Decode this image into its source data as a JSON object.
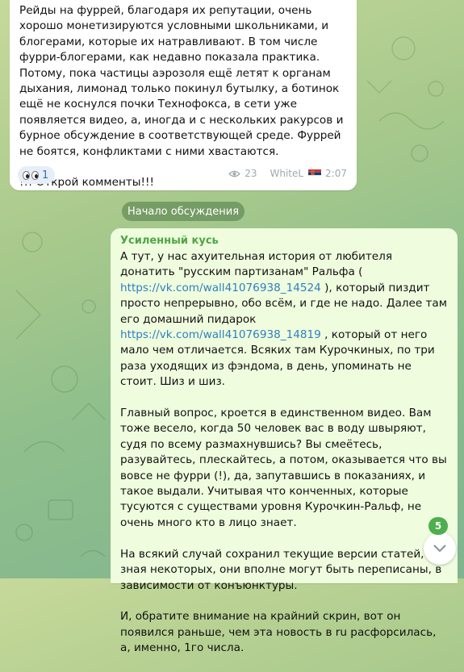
{
  "channel_post": {
    "text": "Рейды на фуррей, благодаря их репутации, очень хорошо монетизируются условными школьниками, и блогерами, которые их натравливают. В том числе фурри-блогерами, как недавно показала практика. Потому, пока частицы аэрозоля ещё летят к органам дыхания, лимонад только покинул бутылку, а ботинок ещё не коснулся почки Технофокса, в сети уже появляется видео, а, иногда и с нескольких ракурсов и бурное обсуждение в соответствующей среде. Фуррей не боятся, конфликтами с ними хвастаются.\n\n!!! Открой комменты!!!",
    "reaction": {
      "emoji": "eyes-icon",
      "count": "1"
    },
    "views": "23",
    "author_signature": "WhiteL",
    "flag": "serbia-flag-icon",
    "time": "2:07"
  },
  "divider": {
    "label": "Начало обсуждения"
  },
  "comment": {
    "author": "Усиленный кусь",
    "paragraphs": [
      [
        {
          "t": "А тут, у нас ахуительная история от любителя донатить \"русским партизанам\" Ральфа ( "
        },
        {
          "t": "https://vk.com/wall41076938_14524",
          "link": true
        },
        {
          "t": " ), который пиздит просто непрерывно, обо всём, и где не надо. Далее там его домашний пидарок "
        },
        {
          "t": "https://vk.com/wall41076938_14819",
          "link": true
        },
        {
          "t": " , который от него мало чем отличается. Всяких там Курочкиных, по три раза уходящих из фэндома, в день, упоминать не стоит. Шиз и шиз."
        }
      ],
      [
        {
          "t": "Главный вопрос, кроется в единственном видео. Вам тоже весело, когда 50 человек вас в воду швыряют, судя по всему размахнувшись? Вы смеётесь, разувайтесь, плескайтесь, а потом, оказывается что вы вовсе не фурри (!), да, запутавшись в показаниях, и такое выдали. Учитывая что конченных, которые тусуются с существами уровня Курочкин-Ральф, не очень много кто в лицо знает."
        }
      ],
      [
        {
          "t": "На всякий случай сохранил текущие версии статей, т.к. зная некоторых, они вполне могут быть переписаны, в зависимости от конъюнктуры."
        }
      ],
      [
        {
          "t": "И, обратите внимание на крайний скрин, вот он появился раньше, чем эта новость в ru расфорсилась, а, именно, 1го числа."
        }
      ]
    ]
  },
  "scroll_down": {
    "unread_count": "5",
    "icon": "chevron-down-icon"
  },
  "colors": {
    "link": "#2e7fc0",
    "author": "#4fa546",
    "comment_bubble": "#effdde",
    "badge": "#4fae4e"
  }
}
